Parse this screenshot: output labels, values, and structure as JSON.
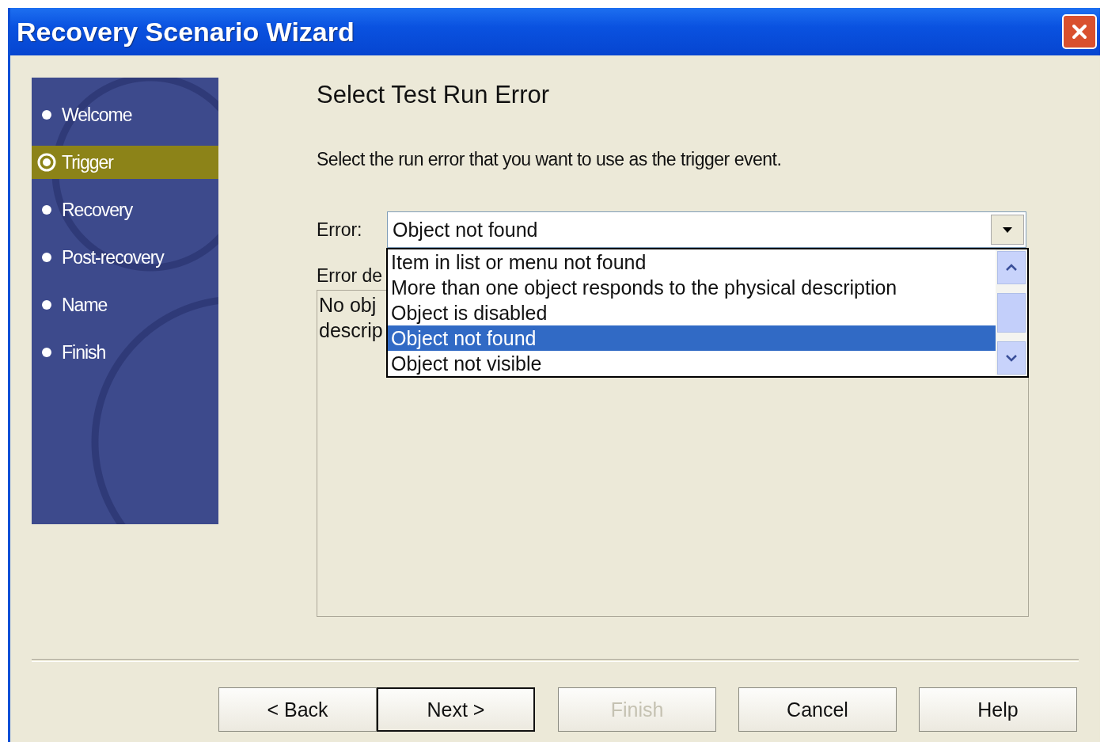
{
  "window": {
    "title": "Recovery Scenario Wizard"
  },
  "steps": [
    {
      "label": "Welcome",
      "selected": false
    },
    {
      "label": "Trigger",
      "selected": true
    },
    {
      "label": "Recovery",
      "selected": false
    },
    {
      "label": "Post-recovery",
      "selected": false
    },
    {
      "label": "Name",
      "selected": false
    },
    {
      "label": "Finish",
      "selected": false
    }
  ],
  "heading": "Select Test Run Error",
  "instruction": "Select the run error that you want to use as the trigger event.",
  "error_field": {
    "label": "Error:",
    "value": "Object not found",
    "expanded": true,
    "options": [
      {
        "label": "Item in list or menu not found",
        "selected": false
      },
      {
        "label": "More than one object responds to the physical description",
        "selected": false
      },
      {
        "label": "Object is disabled",
        "selected": false
      },
      {
        "label": "Object not found",
        "selected": true
      },
      {
        "label": "Object not visible",
        "selected": false
      }
    ]
  },
  "description": {
    "label": "Error de",
    "lines": [
      "No obj",
      "descrip"
    ]
  },
  "buttons": [
    {
      "label": "< Back",
      "disabled": false,
      "default": false
    },
    {
      "label": "Next >",
      "disabled": false,
      "default": true
    },
    {
      "label": "Finish",
      "disabled": true,
      "default": false
    },
    {
      "label": "Cancel",
      "disabled": false,
      "default": false
    },
    {
      "label": "Help",
      "disabled": false,
      "default": false
    }
  ]
}
